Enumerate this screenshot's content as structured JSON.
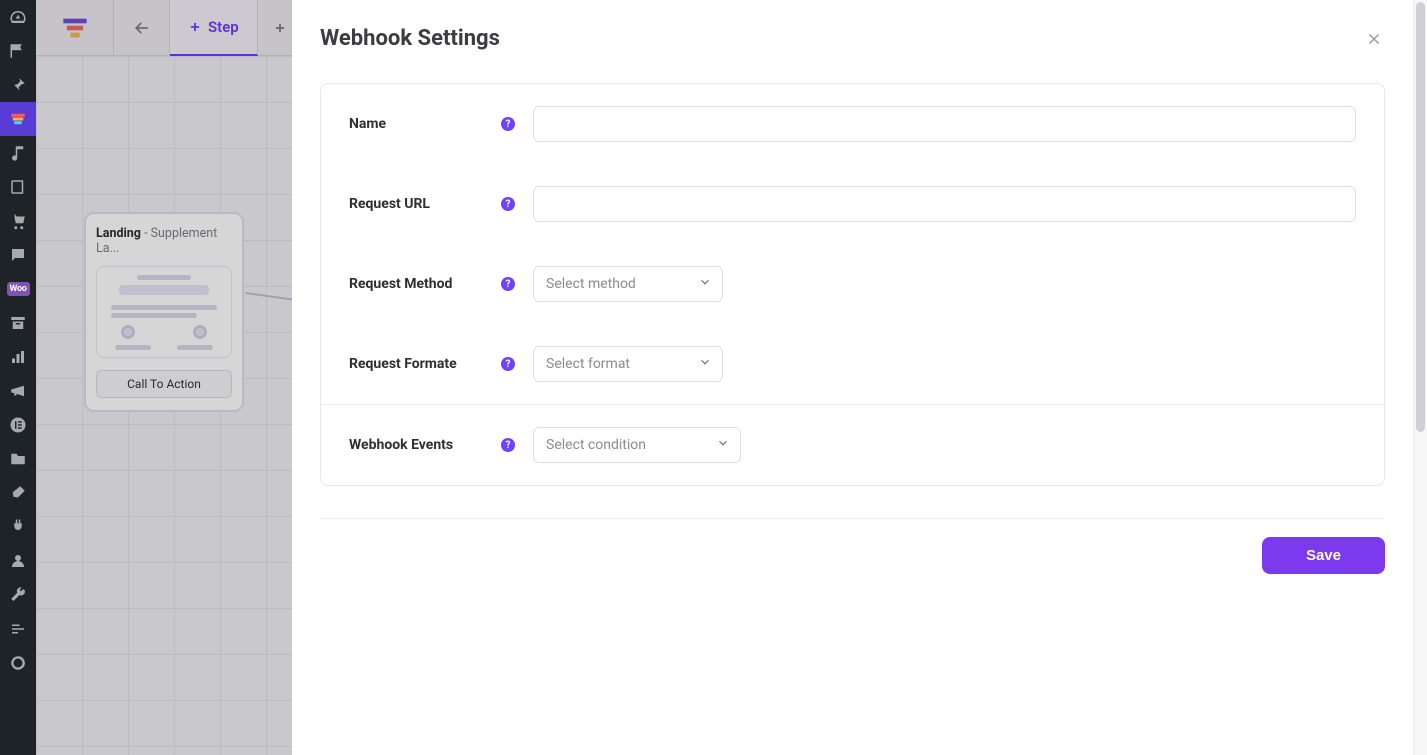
{
  "topbar": {
    "step_tab_label": "Step"
  },
  "canvas": {
    "card": {
      "title": "Landing",
      "subtitle": "- Supplement La...",
      "cta_label": "Call To Action"
    }
  },
  "panel": {
    "title": "Webhook Settings",
    "labels": {
      "name": "Name",
      "request_url": "Request URL",
      "request_method": "Request Method",
      "request_format": "Request Formate",
      "webhook_events": "Webhook Events"
    },
    "placeholders": {
      "method": "Select method",
      "format": "Select format",
      "condition": "Select condition"
    },
    "values": {
      "name": "",
      "request_url": ""
    },
    "save_label": "Save"
  }
}
